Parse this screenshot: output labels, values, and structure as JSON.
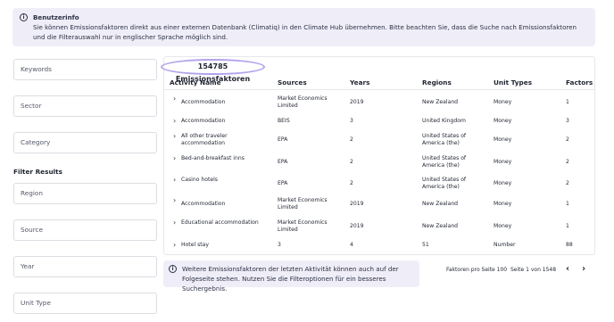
{
  "info": {
    "icon": "info-icon",
    "title": "Benutzerinfo",
    "text": "Sie können Emissionsfaktoren direkt aus einer externen Datenbank (Climatiq) in den Climate Hub übernehmen. Bitte beachten Sie, dass die Suche nach Emissionsfaktoren und die Filterauswahl nur in englischer Sprache möglich sind."
  },
  "filters": {
    "keywords": "Keywords",
    "sector": "Sector",
    "category": "Category",
    "results_title": "Filter Results",
    "region": "Region",
    "source": "Source",
    "year": "Year",
    "unit_type": "Unit Type"
  },
  "results": {
    "count": "154785 Emissionsfaktoren",
    "columns": [
      "Activity Name",
      "Sources",
      "Years",
      "Regions",
      "Unit Types",
      "Factors"
    ],
    "rows": [
      [
        "Accommodation",
        "Market Economics Limited",
        "2019",
        "New Zealand",
        "Money",
        "1"
      ],
      [
        "Accommodation",
        "BEIS",
        "3",
        "United Kingdom",
        "Money",
        "3"
      ],
      [
        "All other traveler accommodation",
        "EPA",
        "2",
        "United States of America (the)",
        "Money",
        "2"
      ],
      [
        "Bed-and-breakfast inns",
        "EPA",
        "2",
        "United States of America (the)",
        "Money",
        "2"
      ],
      [
        "Casino hotels",
        "EPA",
        "2",
        "United States of America (the)",
        "Money",
        "2"
      ],
      [
        "Accommodation",
        "Market Economics Limited",
        "2019",
        "New Zealand",
        "Money",
        "1"
      ],
      [
        "Educational accommodation",
        "Market Economics Limited",
        "2019",
        "New Zealand",
        "Money",
        "1"
      ],
      [
        "Hotel stay",
        "3",
        "4",
        "51",
        "Number",
        "88"
      ]
    ]
  },
  "notice": {
    "icon": "info-icon",
    "text": "Weitere Emissionsfaktoren der letzten Aktivität können auch auf der Folgeseite stehen. Nutzen Sie die Filteroptionen für ein besseres Suchergebnis."
  },
  "pagination": {
    "per_page": "Faktoren pro Seite 100",
    "page_info": "Seite 1 von 1548",
    "prev": "‹",
    "next": "›"
  }
}
